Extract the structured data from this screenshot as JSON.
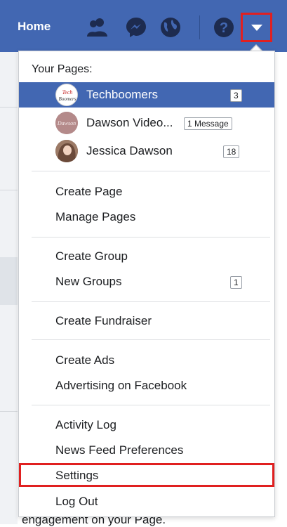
{
  "topbar": {
    "home_label": "Home",
    "icons": [
      "friends-icon",
      "messenger-icon",
      "globe-icon",
      "help-icon",
      "dropdown-arrow-icon"
    ],
    "bg_color": "#4267b2"
  },
  "background": {
    "bottom_text": "engagement on your Page."
  },
  "menu": {
    "section_title": "Your Pages:",
    "pages": [
      {
        "name": "Techboomers",
        "badge": "3",
        "avatar_text": "Tech Boomers",
        "active": true
      },
      {
        "name": "Dawson Video...",
        "badge": "1 Message",
        "avatar_text": "Dawson"
      },
      {
        "name": "Jessica Dawson",
        "badge": "18"
      }
    ],
    "items": {
      "create_page": "Create Page",
      "manage_pages": "Manage Pages",
      "create_group": "Create Group",
      "new_groups": "New Groups",
      "new_groups_badge": "1",
      "create_fundraiser": "Create Fundraiser",
      "create_ads": "Create Ads",
      "advertising": "Advertising on Facebook",
      "activity_log": "Activity Log",
      "news_feed_prefs": "News Feed Preferences",
      "settings": "Settings",
      "log_out": "Log Out"
    },
    "highlight_color": "#e02020"
  }
}
